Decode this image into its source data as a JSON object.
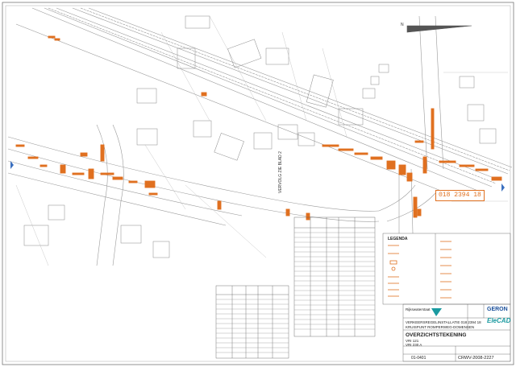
{
  "sheet": {
    "north_arrow_label": "N",
    "match_line_label": "VERVOLG ZIE BLAD 2",
    "code_number": "018 2394 18"
  },
  "legend": {
    "title": "LEGENDA"
  },
  "title_block": {
    "project_main": "VERKEERSREGELINSTALLATIE 018 2394 18",
    "project_sub": "KRUISPUNT ROMPERWEG-DOMENSEN",
    "drawing_title": "OVERZICHTSTEKENING",
    "detail_1": "VRI 121",
    "detail_2": "VRI 230 A",
    "drawing_number": "CRWV-2008-2227",
    "sheet_no": "01-0401",
    "logo_geron": "GERON",
    "logo_elecad": "EleCAD",
    "brand_left": "Rijkswaterstaat"
  },
  "colors": {
    "line": "#9a9a9a",
    "dark": "#555555",
    "accent": "#e07020",
    "blue": "#3a6fbf",
    "teal": "#1a9aa0"
  }
}
